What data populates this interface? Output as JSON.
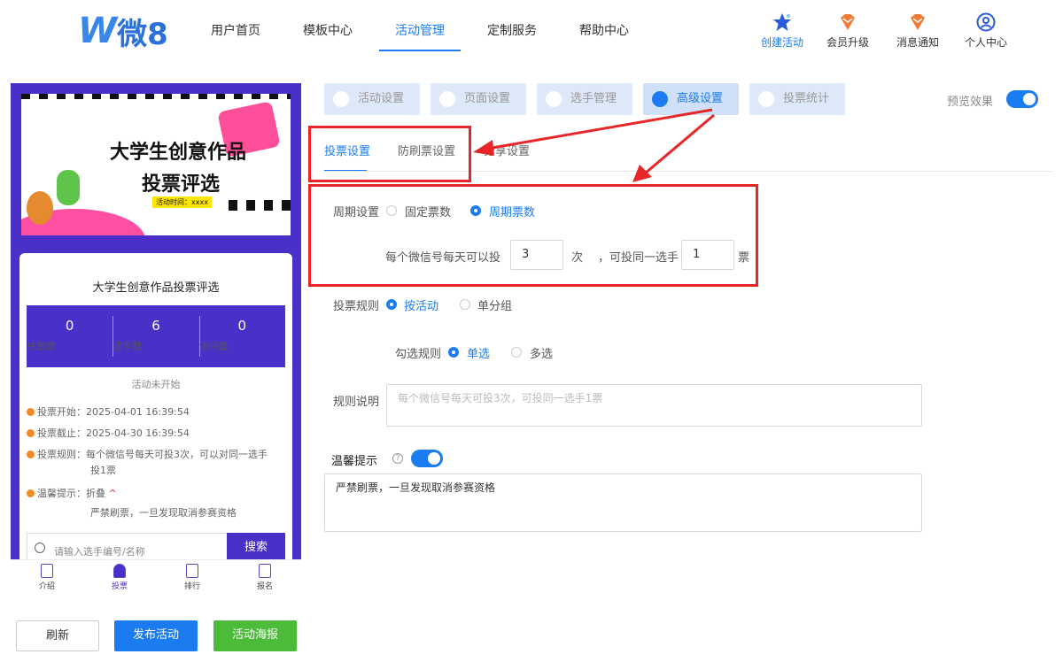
{
  "logo": {
    "mark": "W",
    "text": "微8"
  },
  "nav": [
    {
      "label": "用户首页"
    },
    {
      "label": "模板中心"
    },
    {
      "label": "活动管理"
    },
    {
      "label": "定制服务"
    },
    {
      "label": "帮助中心"
    }
  ],
  "header_icons": [
    {
      "label": "创建活动",
      "icon": "star-icon"
    },
    {
      "label": "会员升级",
      "icon": "diamond-icon"
    },
    {
      "label": "消息通知",
      "icon": "bell-icon"
    },
    {
      "label": "个人中心",
      "icon": "user-icon"
    }
  ],
  "preview": {
    "banner_title_1": "大学生创意作品",
    "banner_title_2": "投票评选",
    "banner_date": "活动时间：xxxx",
    "title": "大学生创意作品投票评选",
    "stats": [
      {
        "value": "0",
        "label": "总票数"
      },
      {
        "value": "6",
        "label": "选手数"
      },
      {
        "value": "0",
        "label": "访问量"
      }
    ],
    "status": "活动未开始",
    "vote_start": "投票开始：2025-04-01 16:39:54",
    "vote_end": "投票截止：2025-04-30 16:39:54",
    "vote_rule_1": "投票规则：每个微信号每天可投3次，可以对同一选手",
    "vote_rule_2": "投1票",
    "tips_label": "温馨提示：折叠",
    "tips_caret": "^",
    "tips_text": "严禁刷票，一旦发现取消参赛资格",
    "search_placeholder": "请输入选手编号/名称",
    "search_button": "搜索",
    "tabbar": [
      {
        "label": "介绍"
      },
      {
        "label": "投票"
      },
      {
        "label": "排行"
      },
      {
        "label": "报名"
      }
    ]
  },
  "bottom_buttons": {
    "refresh": "刷新",
    "publish": "发布活动",
    "poster": "活动海报"
  },
  "panel_tabs": [
    {
      "label": "活动设置"
    },
    {
      "label": "页面设置"
    },
    {
      "label": "选手管理"
    },
    {
      "label": "高级设置"
    },
    {
      "label": "投票统计"
    }
  ],
  "preview_toggle_label": "预览效果",
  "subtabs": [
    {
      "label": "投票设置"
    },
    {
      "label": "防刷票设置"
    },
    {
      "label": "分享设置"
    }
  ],
  "form": {
    "cycle_label": "周期设置",
    "cycle_opt_fixed": "固定票数",
    "cycle_opt_period": "周期票数",
    "per_day_prefix": "每个微信号每天可以投",
    "per_day_value": "3",
    "times_unit": "次",
    "same_player_prefix": "，可投同一选手",
    "same_player_value": "1",
    "votes_unit": "票",
    "rule_label": "投票规则",
    "rule_opt_activity": "按活动",
    "rule_opt_group": "单分组",
    "select_label": "勾选规则",
    "select_opt_single": "单选",
    "select_opt_multi": "多选",
    "desc_label": "规则说明",
    "desc_placeholder": "每个微信号每天可投3次，可投同一选手1票",
    "tips_label": "温馨提示",
    "tips_help": "?",
    "tips_text": "严禁刷票，一旦发现取消参赛资格"
  }
}
